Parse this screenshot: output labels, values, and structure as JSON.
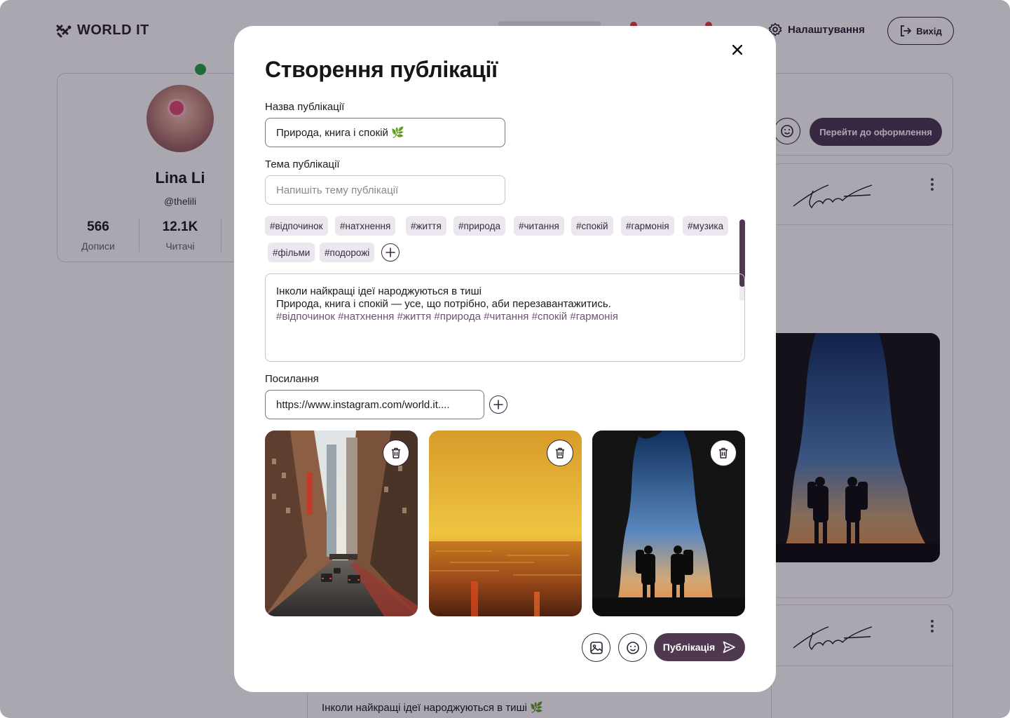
{
  "app": {
    "logo": "WORLD IT",
    "settings_label": "Налаштування",
    "logout_label": "Вихід"
  },
  "profile": {
    "name": "Lina Li",
    "handle": "@thelili",
    "stats": [
      {
        "value": "566",
        "label": "Дописи"
      },
      {
        "value": "12.1K",
        "label": "Читачі"
      }
    ]
  },
  "compose": {
    "goto_label": "Перейти до оформлення"
  },
  "feed": {
    "post_text_line1": "Інколи найкращі ідеї народжуються в тиші 🌿"
  },
  "modal": {
    "title": "Створення публікації",
    "name_label": "Назва публікації",
    "name_value": "Природа, книга і спокій 🌿",
    "topic_label": "Тема публікації",
    "topic_placeholder": "Напишіть тему публікації",
    "tags": [
      "#відпочинок",
      "#натхнення",
      "#життя",
      "#природа",
      "#читання",
      "#спокій",
      "#гармонія",
      "#музика",
      "#фільми",
      "#подорожі"
    ],
    "body_line1": "Інколи найкращі ідеї народжуються в тиші",
    "body_line2": "Природа, книга і спокій — усе, що потрібно, аби перезавантажитись.",
    "body_hashtags": "#відпочинок #натхнення #життя #природа #читання #спокій #гармонія",
    "link_label": "Посилання",
    "link_value": "https://www.instagram.com/world.it....",
    "photos": [
      "city-street",
      "sunset-sea",
      "hikers-cave"
    ],
    "publish_label": "Публікація"
  },
  "colors": {
    "accent": "#4e3950",
    "tag_bg": "#ece6ee",
    "overlay": "#160c28",
    "online": "#27a247"
  }
}
